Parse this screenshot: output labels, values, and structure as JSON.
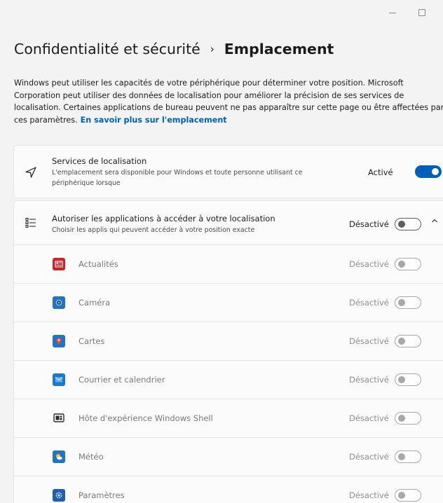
{
  "window": {
    "minimize_icon": "minimize-icon",
    "maximize_icon": "maximize-icon"
  },
  "breadcrumb": {
    "parent": "Confidentialité et sécurité",
    "separator": "›",
    "current": "Emplacement"
  },
  "description": {
    "lines": [
      "Windows peut utiliser les capacités de votre périphérique pour déterminer votre position. Microsoft",
      "Corporation peut utiliser des données de localisation pour améliorer la précision de ses services de",
      "localisation. Certaines applications de bureau peuvent ne pas apparaître sur cette page ou être affectées par",
      "ces paramètres."
    ],
    "link": "En savoir plus sur l'emplacement"
  },
  "location_services": {
    "icon": "location-arrow-icon",
    "title": "Services de localisation",
    "subtitle_lines": [
      "L'emplacement sera disponible pour Windows et toute personne utilisant ce",
      "périphérique lorsque"
    ],
    "state_label": "Activé",
    "enabled": true
  },
  "app_access": {
    "icon": "list-icon",
    "title": "Autoriser les applications à accéder à votre localisation",
    "subtitle": "Choisir les applis qui peuvent accéder à votre position exacte",
    "state_label": "Désactivé",
    "enabled": false,
    "expanded": true,
    "chevron_icon": "chevron-up-icon"
  },
  "apps": [
    {
      "name": "Actualités",
      "state": "Désactivé",
      "enabled": false,
      "icon": "news-icon",
      "color": "#c4262e"
    },
    {
      "name": "Caméra",
      "state": "Désactivé",
      "enabled": false,
      "icon": "camera-icon",
      "color": "#1f74c4"
    },
    {
      "name": "Cartes",
      "state": "Désactivé",
      "enabled": false,
      "icon": "maps-icon",
      "color": "#1f74c4"
    },
    {
      "name": "Courrier et calendrier",
      "state": "Désactivé",
      "enabled": false,
      "icon": "mail-icon",
      "color": "#1a78d4"
    },
    {
      "name": "Hôte d'expérience Windows Shell",
      "state": "Désactivé",
      "enabled": false,
      "icon": "shell-icon",
      "color": "#3a3a3a"
    },
    {
      "name": "Météo",
      "state": "Désactivé",
      "enabled": false,
      "icon": "weather-icon",
      "color": "#1f74c4"
    },
    {
      "name": "Paramètres",
      "state": "Désactivé",
      "enabled": false,
      "icon": "settings-icon",
      "color": "#1f5fae"
    }
  ],
  "colors": {
    "accent": "#005fb8",
    "background": "#f3f3f3",
    "card": "#fbfbfb"
  }
}
